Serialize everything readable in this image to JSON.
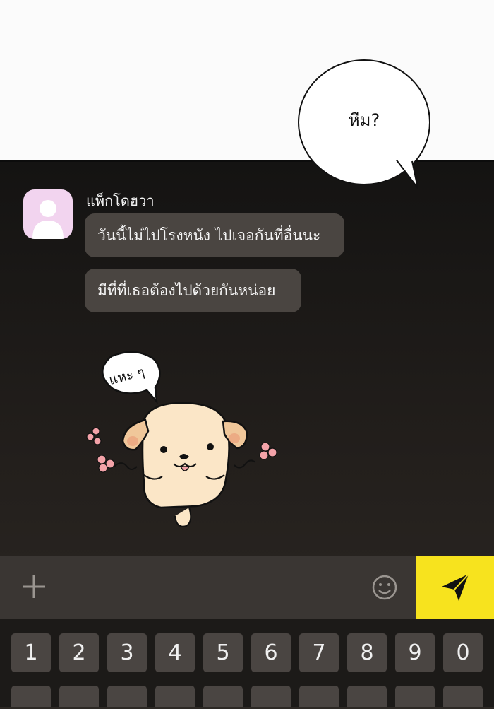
{
  "speech_bubble": {
    "text": "หืม?"
  },
  "chat": {
    "sender": {
      "name": "แพ็กโดฮวา"
    },
    "messages": [
      {
        "text": "วันนี้ไม่ไปโรงหนัง ไปเจอกันที่อื่นนะ"
      },
      {
        "text": "มีที่ที่เธอต้องไปด้วยกันหน่อย"
      }
    ],
    "sticker": {
      "caption": "แหะ ๆ"
    }
  },
  "input_bar": {
    "plus_icon": "plus-icon",
    "emoji_icon": "smiley-icon",
    "send_icon": "send-arrow-icon",
    "send_color": "#f7e31e"
  },
  "keyboard": {
    "keys": [
      "1",
      "2",
      "3",
      "4",
      "5",
      "6",
      "7",
      "8",
      "9",
      "0"
    ]
  }
}
